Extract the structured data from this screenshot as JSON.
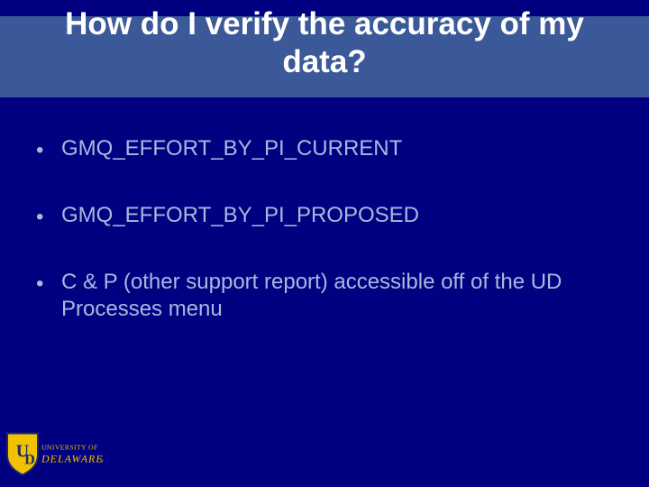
{
  "title": "How do I verify the accuracy of my data?",
  "bullets": [
    "GMQ_EFFORT_BY_PI_CURRENT",
    "GMQ_EFFORT_BY_PI_PROPOSED",
    "C & P (other support report) accessible off of the UD Processes menu"
  ],
  "logo": {
    "line1": "UNIVERSITY OF",
    "line2": "DELAWARE"
  }
}
